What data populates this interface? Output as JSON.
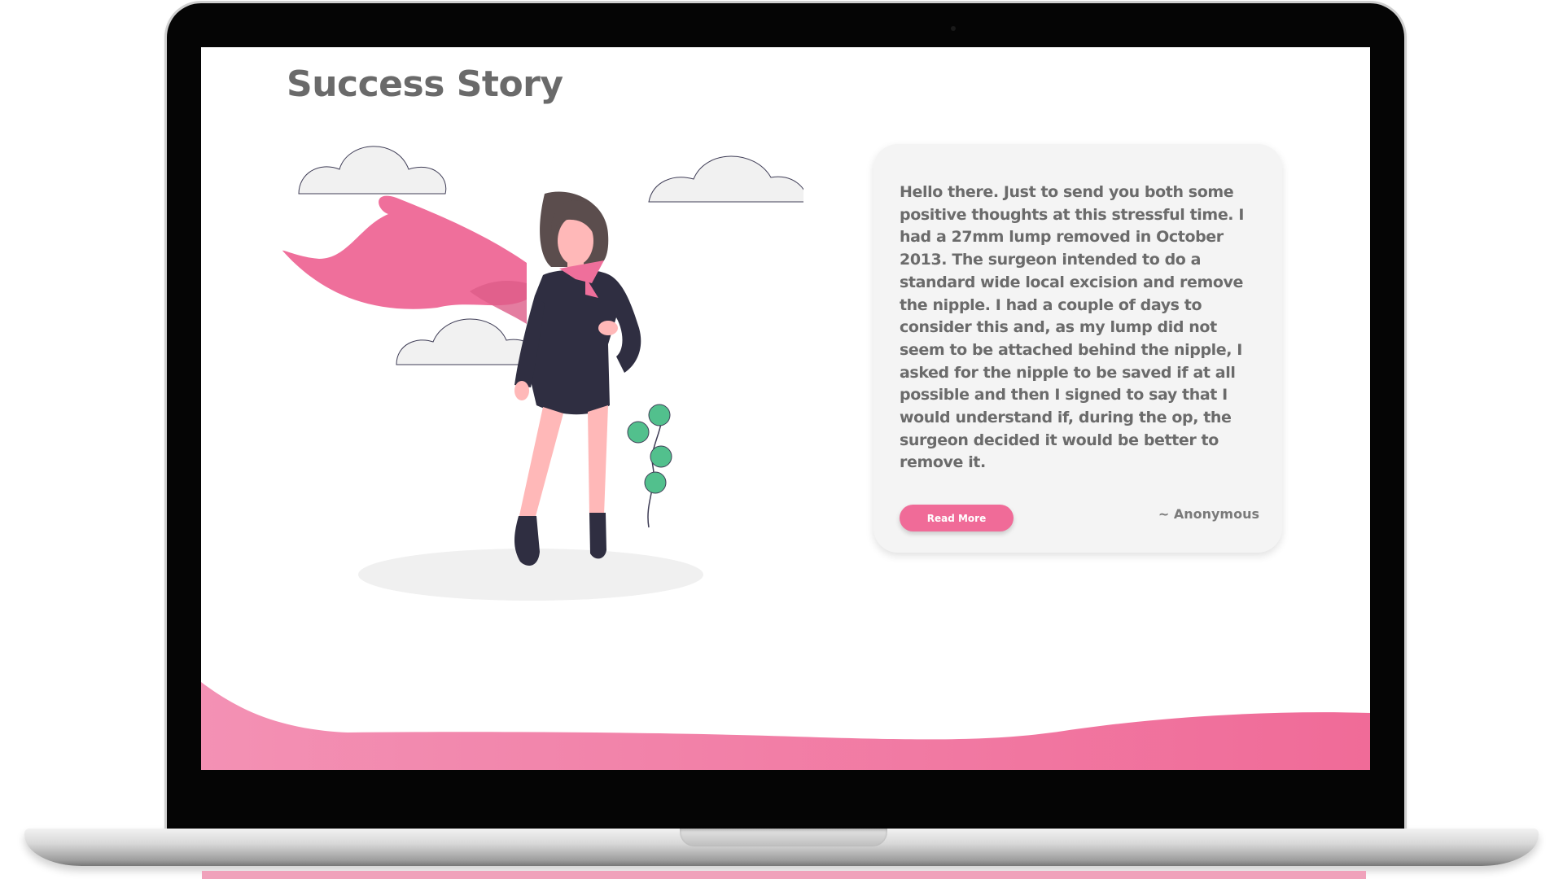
{
  "page": {
    "title": "Success Story"
  },
  "story": {
    "text": "Hello there. Just to send you both some positive thoughts at this stressful time. I had a 27mm lump removed in October 2013. The surgeon intended to do a standard wide local excision and remove the nipple. I had a couple of days to consider this and, as my lump did not seem to be attached behind the nipple, I asked for the nipple to be saved if at all possible and then I signed to say that I would understand if, during the op, the surgeon decided it would be better to remove it.",
    "read_more_label": "Read More",
    "author": "~ Anonymous"
  },
  "colors": {
    "accent_pink": "#f06b98",
    "title_gray": "#6a6a6a",
    "card_bg": "#f4f4f4",
    "outfit": "#2f2e41",
    "plant_green": "#52c08d"
  },
  "icons": {
    "illustration": "superhero-woman-illustration"
  }
}
